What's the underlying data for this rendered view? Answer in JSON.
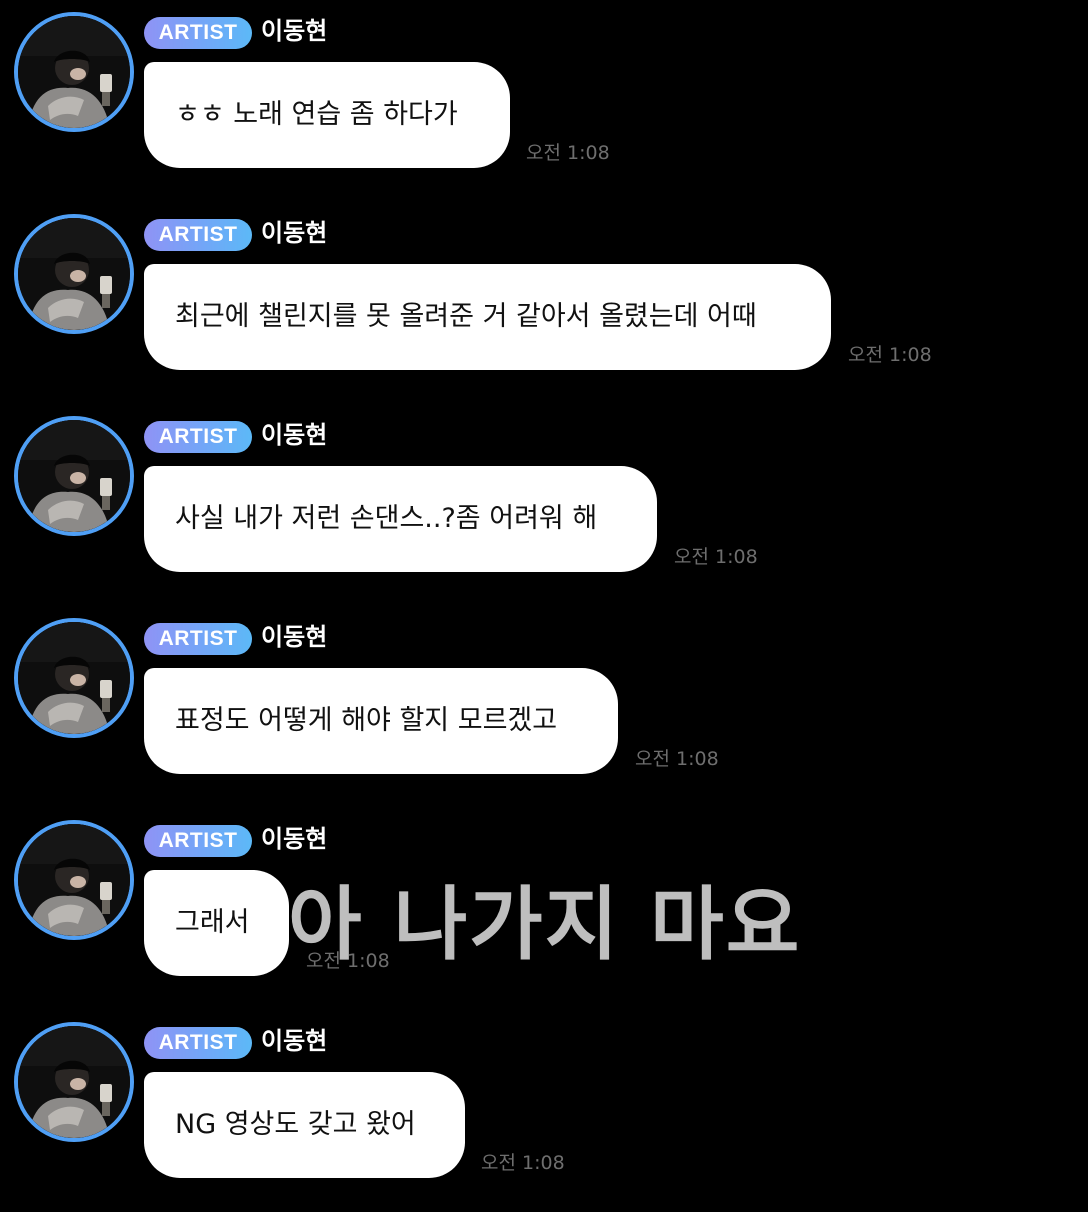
{
  "messages": [
    {
      "badge": "ARTIST",
      "sender": "이동현",
      "text": "ㅎㅎ 노래 연습 좀 하다가",
      "time": "오전 1:08"
    },
    {
      "badge": "ARTIST",
      "sender": "이동현",
      "text": "최근에 챌린지를 못 올려준 거 같아서 올렸는데 어때",
      "time": "오전 1:08"
    },
    {
      "badge": "ARTIST",
      "sender": "이동현",
      "text": "사실 내가 저런 손댄스..?좀 어려워 해",
      "time": "오전 1:08"
    },
    {
      "badge": "ARTIST",
      "sender": "이동현",
      "text": "표정도 어떻게 해야 할지 모르겠고",
      "time": "오전 1:08"
    },
    {
      "badge": "ARTIST",
      "sender": "이동현",
      "text": "그래서",
      "time": "오전 1:08"
    },
    {
      "badge": "ARTIST",
      "sender": "이동현",
      "text": "NG 영상도 갖고 왔어",
      "time": "오전 1:08"
    }
  ],
  "overlay_caption": "아 나가지 마요",
  "colors": {
    "background": "#000000",
    "avatar_ring": "#4f9ff5",
    "badge_gradient_start": "#8f93f5",
    "badge_gradient_end": "#5cb9f7",
    "bubble": "#ffffff",
    "timestamp": "#6e6e6e"
  },
  "icons": {
    "avatar": "profile-photo-icon"
  }
}
